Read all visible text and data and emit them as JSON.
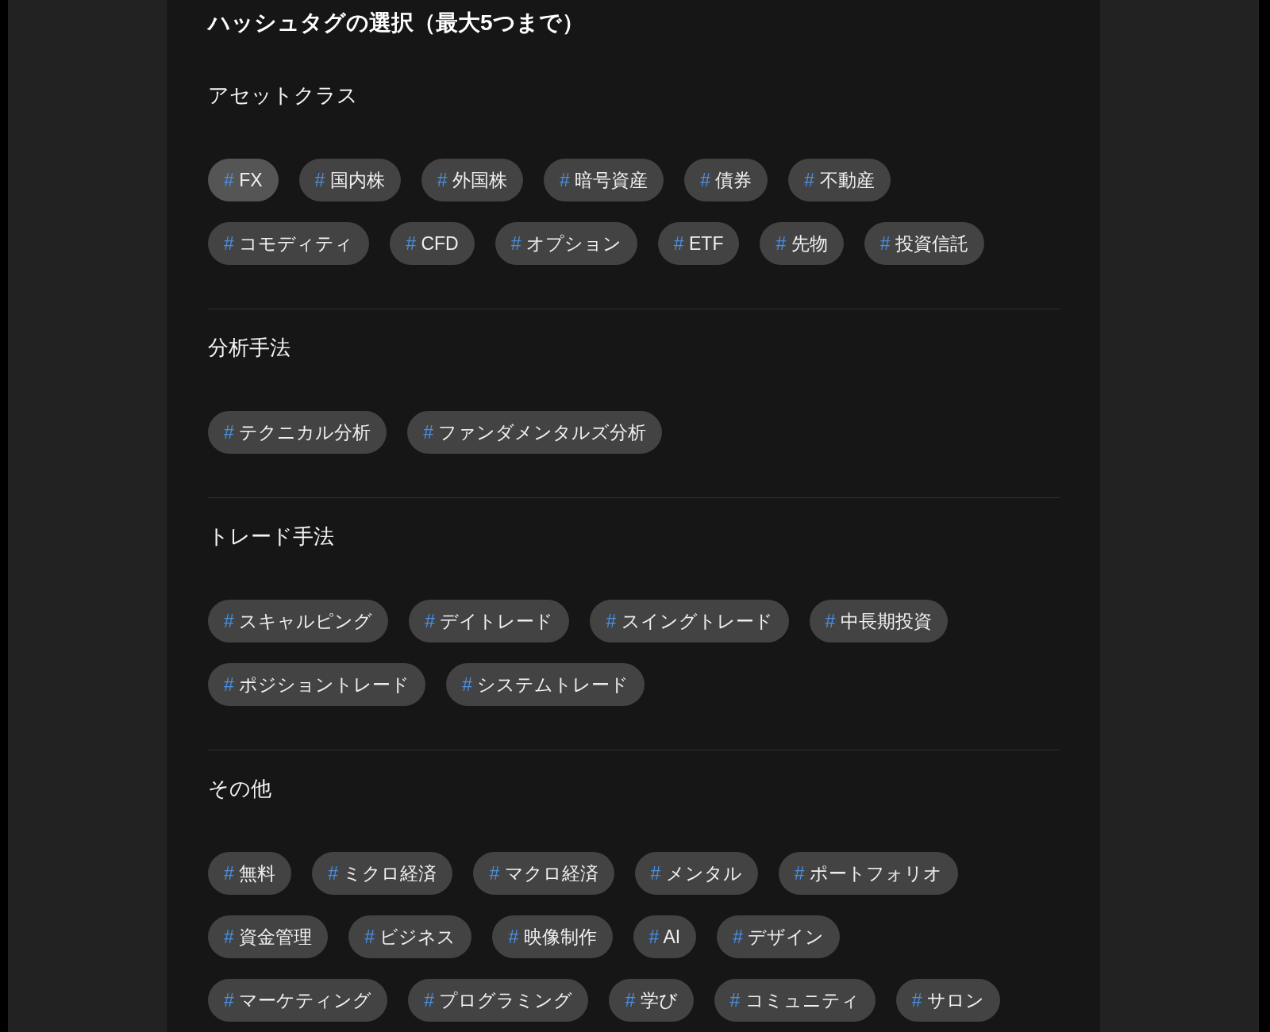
{
  "title": "ハッシュタグの選択（最大5つまで）",
  "sections": [
    {
      "heading": "アセットクラス",
      "tags": [
        {
          "hash": "#",
          "label": "FX",
          "selected": true
        },
        {
          "hash": "#",
          "label": "国内株",
          "selected": false
        },
        {
          "hash": "#",
          "label": "外国株",
          "selected": false
        },
        {
          "hash": "#",
          "label": "暗号資産",
          "selected": false
        },
        {
          "hash": "#",
          "label": "債券",
          "selected": false
        },
        {
          "hash": "#",
          "label": "不動産",
          "selected": false
        },
        {
          "hash": "#",
          "label": "コモディティ",
          "selected": false
        },
        {
          "hash": "#",
          "label": "CFD",
          "selected": false
        },
        {
          "hash": "#",
          "label": "オプション",
          "selected": false
        },
        {
          "hash": "#",
          "label": "ETF",
          "selected": false
        },
        {
          "hash": "#",
          "label": "先物",
          "selected": false
        },
        {
          "hash": "#",
          "label": "投資信託",
          "selected": false
        }
      ]
    },
    {
      "heading": "分析手法",
      "tags": [
        {
          "hash": "#",
          "label": "テクニカル分析",
          "selected": false
        },
        {
          "hash": "#",
          "label": "ファンダメンタルズ分析",
          "selected": false
        }
      ]
    },
    {
      "heading": "トレード手法",
      "tags": [
        {
          "hash": "#",
          "label": "スキャルピング",
          "selected": false
        },
        {
          "hash": "#",
          "label": "デイトレード",
          "selected": false
        },
        {
          "hash": "#",
          "label": "スイングトレード",
          "selected": false
        },
        {
          "hash": "#",
          "label": "中長期投資",
          "selected": false
        },
        {
          "hash": "#",
          "label": "ポジショントレード",
          "selected": false
        },
        {
          "hash": "#",
          "label": "システムトレード",
          "selected": false
        }
      ]
    },
    {
      "heading": "その他",
      "tags": [
        {
          "hash": "#",
          "label": "無料",
          "selected": false
        },
        {
          "hash": "#",
          "label": "ミクロ経済",
          "selected": false
        },
        {
          "hash": "#",
          "label": "マクロ経済",
          "selected": false
        },
        {
          "hash": "#",
          "label": "メンタル",
          "selected": false
        },
        {
          "hash": "#",
          "label": "ポートフォリオ",
          "selected": false
        },
        {
          "hash": "#",
          "label": "資金管理",
          "selected": false
        },
        {
          "hash": "#",
          "label": "ビジネス",
          "selected": false
        },
        {
          "hash": "#",
          "label": "映像制作",
          "selected": false
        },
        {
          "hash": "#",
          "label": "AI",
          "selected": false
        },
        {
          "hash": "#",
          "label": "デザイン",
          "selected": false
        },
        {
          "hash": "#",
          "label": "マーケティング",
          "selected": false
        },
        {
          "hash": "#",
          "label": "プログラミング",
          "selected": false
        },
        {
          "hash": "#",
          "label": "学び",
          "selected": false
        },
        {
          "hash": "#",
          "label": "コミュニティ",
          "selected": false
        },
        {
          "hash": "#",
          "label": "サロン",
          "selected": false
        }
      ]
    }
  ]
}
